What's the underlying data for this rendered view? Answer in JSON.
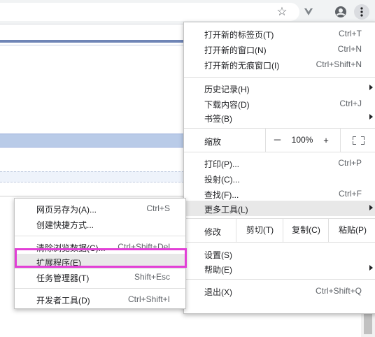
{
  "toolbar": {
    "icons": [
      "star-icon",
      "extension-icon",
      "profile-icon",
      "menu-dots-icon"
    ]
  },
  "menu": {
    "new_tab": {
      "label": "打开新的标签页(T)",
      "shortcut": "Ctrl+T"
    },
    "new_window": {
      "label": "打开新的窗口(N)",
      "shortcut": "Ctrl+N"
    },
    "new_incognito": {
      "label": "打开新的无痕窗口(I)",
      "shortcut": "Ctrl+Shift+N"
    },
    "history": {
      "label": "历史记录(H)"
    },
    "downloads": {
      "label": "下载内容(D)",
      "shortcut": "Ctrl+J"
    },
    "bookmarks": {
      "label": "书签(B)"
    },
    "zoom": {
      "label": "缩放",
      "minus": "－",
      "value": "100%",
      "plus": "+"
    },
    "print": {
      "label": "打印(P)...",
      "shortcut": "Ctrl+P"
    },
    "cast": {
      "label": "投射(C)..."
    },
    "find": {
      "label": "查找(F)...",
      "shortcut": "Ctrl+F"
    },
    "more_tools": {
      "label": "更多工具(L)"
    },
    "edit": {
      "label": "修改",
      "cut": "剪切(T)",
      "copy": "复制(C)",
      "paste": "粘贴(P)"
    },
    "settings": {
      "label": "设置(S)"
    },
    "help": {
      "label": "帮助(E)"
    },
    "exit": {
      "label": "退出(X)",
      "shortcut": "Ctrl+Shift+Q"
    }
  },
  "submenu": {
    "save_as": {
      "label": "网页另存为(A)...",
      "shortcut": "Ctrl+S"
    },
    "create_shortcut": {
      "label": "创建快捷方式..."
    },
    "clear_data": {
      "label": "清除浏览数据(C)...",
      "shortcut": "Ctrl+Shift+Del"
    },
    "extensions": {
      "label": "扩展程序(E)"
    },
    "task_manager": {
      "label": "任务管理器(T)",
      "shortcut": "Shift+Esc"
    },
    "devtools": {
      "label": "开发者工具(D)",
      "shortcut": "Ctrl+Shift+I"
    }
  },
  "colors": {
    "highlight_box": "#e23fd6",
    "hover_bg": "#e8e8e8"
  }
}
